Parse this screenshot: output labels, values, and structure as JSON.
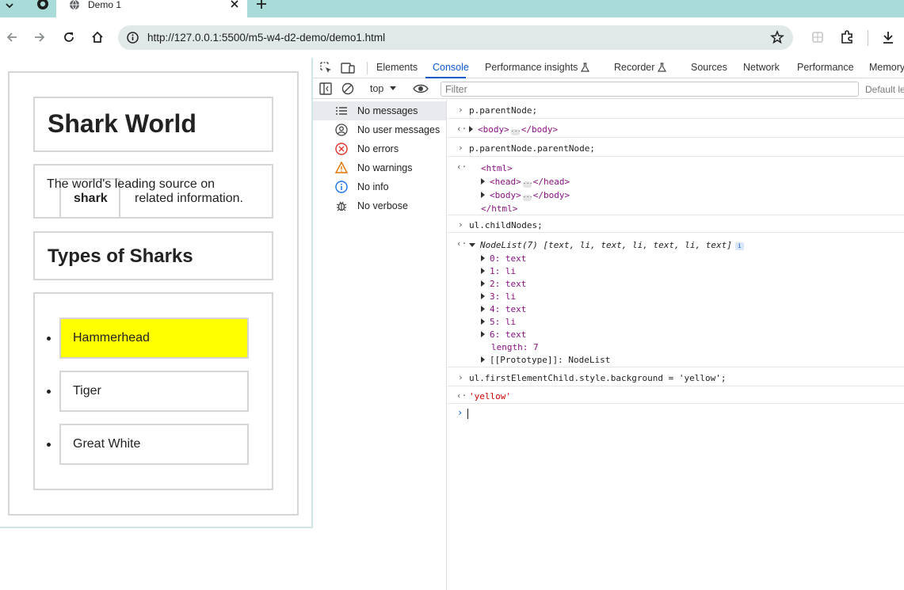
{
  "browser": {
    "tab": {
      "title": "Demo 1"
    },
    "address_bar": {
      "url": "http://127.0.0.1:5500/m5-w4-d2-demo/demo1.html"
    }
  },
  "page": {
    "heading": "Shark World",
    "intro": {
      "text_before": "The world's leading source on",
      "strong": "shark",
      "text_after": "related information."
    },
    "subheading": "Types of Sharks",
    "list": [
      {
        "label": "Hammerhead",
        "background": "#ffff00"
      },
      {
        "label": "Tiger",
        "background": "#ffffff"
      },
      {
        "label": "Great White",
        "background": "#ffffff"
      }
    ]
  },
  "devtools": {
    "tabs": [
      "Elements",
      "Console",
      "Performance insights",
      "Recorder",
      "Sources",
      "Network",
      "Performance",
      "Memory"
    ],
    "active_tab": "Console",
    "toolbar": {
      "context": "top",
      "filter_placeholder": "Filter",
      "levels": "Default le"
    },
    "sidebar": [
      {
        "label": "No messages",
        "icon": "list-icon",
        "selected": true
      },
      {
        "label": "No user messages",
        "icon": "user-icon"
      },
      {
        "label": "No errors",
        "icon": "error-icon"
      },
      {
        "label": "No warnings",
        "icon": "warning-icon"
      },
      {
        "label": "No info",
        "icon": "info-icon"
      },
      {
        "label": "No verbose",
        "icon": "bug-icon"
      }
    ],
    "console": {
      "cmd1": "p.parentNode;",
      "cmd2": "p.parentNode.parentNode;",
      "cmd3": "ul.childNodes;",
      "nodelist_summary": "NodeList(7) [text, li, text, li, text, li, text]",
      "nodelist_items": [
        "0: text",
        "1: li",
        "2: text",
        "3: li",
        "4: text",
        "5: li",
        "6: text"
      ],
      "length_line": "length: 7",
      "proto_line": "[[Prototype]]: NodeList",
      "cmd4": "ul.firstElementChild.style.background = 'yellow';",
      "result4": "'yellow'",
      "tags": {
        "body_open": "<body>",
        "body_close": "</body>",
        "html_open": "<html>",
        "html_close": "</html>",
        "head_open": "<head>",
        "head_close": "</head>"
      }
    }
  },
  "colors": {
    "tabstrip": "#a9dcd9",
    "accent": "#0b57d0",
    "highlight": "#ffff00"
  }
}
